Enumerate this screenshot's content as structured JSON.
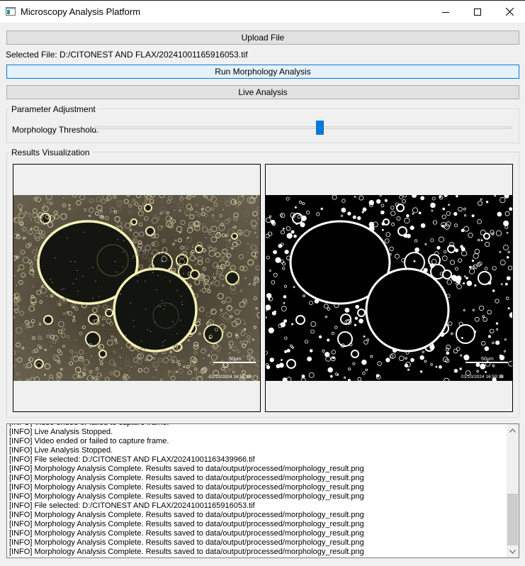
{
  "window": {
    "title": "Microscopy Analysis Platform",
    "icon": "app-window-icon"
  },
  "toolbar": {
    "upload_label": "Upload File",
    "run_label": "Run Morphology Analysis",
    "live_label": "Live Analysis"
  },
  "selected_file": "Selected File: D:/CITONEST AND FLAX/20241001165916053.tif",
  "parameters": {
    "group_title": "Parameter Adjustment",
    "threshold_label": "Morphology Threshold:",
    "threshold_level": 0.54
  },
  "results": {
    "group_title": "Results Visualization",
    "original_scale": "50μm",
    "original_timestamp": "01/10/2024 16:59:16",
    "processed_scale": "50μm",
    "processed_timestamp": "01/10/2024 16:59:16"
  },
  "log": {
    "lines": [
      "[INFO] Video ended or failed to capture frame.",
      "[INFO] Live Analysis Stopped.",
      "[INFO] Video ended or failed to capture frame.",
      "[INFO] Live Analysis Stopped.",
      "[INFO] File selected: D:/CITONEST AND FLAX/20241001163439966.tif",
      "[INFO] Morphology Analysis Complete. Results saved to data/output/processed/morphology_result.png",
      "[INFO] Morphology Analysis Complete. Results saved to data/output/processed/morphology_result.png",
      "[INFO] Morphology Analysis Complete. Results saved to data/output/processed/morphology_result.png",
      "[INFO] Morphology Analysis Complete. Results saved to data/output/processed/morphology_result.png",
      "[INFO] File selected: D:/CITONEST AND FLAX/20241001165916053.tif",
      "[INFO] Morphology Analysis Complete. Results saved to data/output/processed/morphology_result.png",
      "[INFO] Morphology Analysis Complete. Results saved to data/output/processed/morphology_result.png",
      "[INFO] Morphology Analysis Complete. Results saved to data/output/processed/morphology_result.png",
      "[INFO] Morphology Analysis Complete. Results saved to data/output/processed/morphology_result.png",
      "[INFO] Morphology Analysis Complete. Results saved to data/output/processed/morphology_result.png"
    ]
  }
}
